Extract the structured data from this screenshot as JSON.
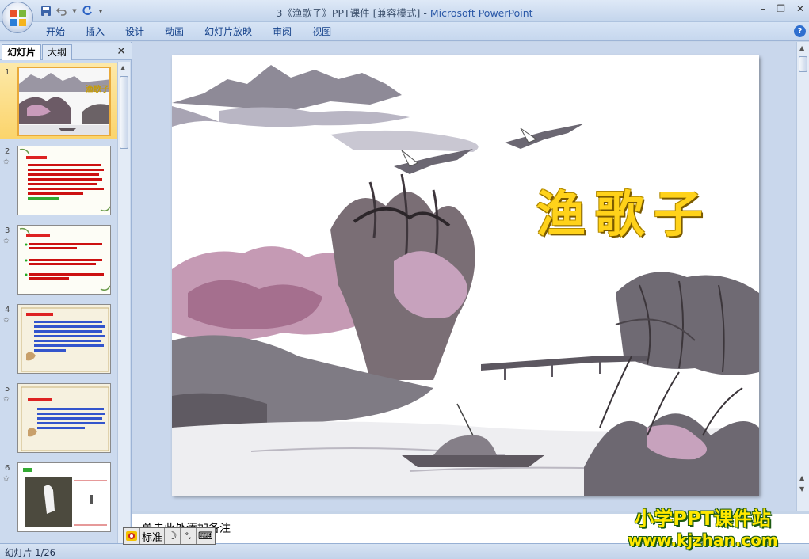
{
  "window": {
    "title": "3《渔歌子》PPT课件 [兼容模式]",
    "app_name": "Microsoft PowerPoint",
    "separator": " - ",
    "controls": {
      "minimize": "–",
      "restore": "❐",
      "close": "✕"
    }
  },
  "ribbon": {
    "tabs": [
      "开始",
      "插入",
      "设计",
      "动画",
      "幻灯片放映",
      "审阅",
      "视图"
    ],
    "help": "?"
  },
  "left_pane": {
    "tabs": {
      "slides": "幻灯片",
      "outline": "大纲"
    },
    "close": "✕",
    "thumbnails": [
      {
        "number": "1",
        "selected": true
      },
      {
        "number": "2",
        "anim": "✩"
      },
      {
        "number": "3",
        "anim": "✩"
      },
      {
        "number": "4",
        "anim": "✩"
      },
      {
        "number": "5",
        "anim": "✩"
      },
      {
        "number": "6",
        "anim": "✩"
      }
    ]
  },
  "slide": {
    "title": "渔歌子"
  },
  "notes": {
    "placeholder": "单击此处添加备注"
  },
  "ime": {
    "mode": "标准",
    "moon": "☽",
    "punct": "°,",
    "keyboard": "⌨"
  },
  "watermark": {
    "line1": "小学PPT课件站",
    "line2": "www.kjzhan.com"
  },
  "status": {
    "slide_counter": "幻灯片 1/26"
  },
  "colors": {
    "title_yellow": "#ffd21a",
    "ribbon_text": "#15428b",
    "selected_thumb": "#fbd46b"
  }
}
